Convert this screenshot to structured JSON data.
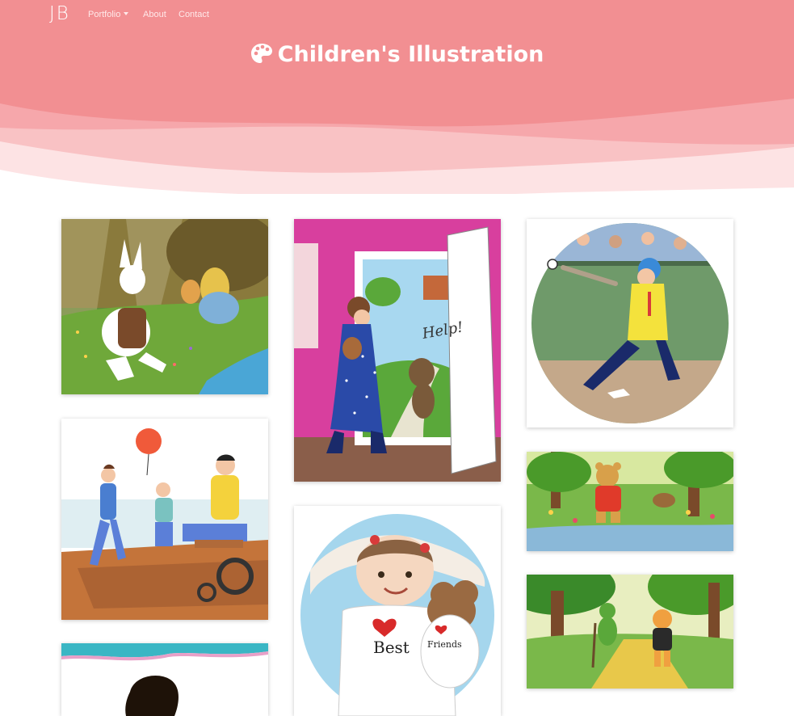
{
  "navbar": {
    "brand": "JB",
    "links": {
      "portfolio": "Portfolio",
      "about": "About",
      "contact": "Contact"
    }
  },
  "hero": {
    "title": "Children's Illustration",
    "icon": "palette-icon"
  },
  "colors": {
    "header_pink": "#f28f92",
    "wave_light": "#f8b3b6",
    "wave_pale": "#fddadb",
    "wave_white": "#fdeeee"
  },
  "gallery": {
    "items": [
      {
        "subject": "white-rabbit-with-alice"
      },
      {
        "subject": "girl-at-door-with-bear",
        "sign_text": "Help!"
      },
      {
        "subject": "boy-batting-baseball"
      },
      {
        "subject": "family-playing-with-balloon"
      },
      {
        "subject": "girl-with-teddy-bear",
        "shirt_text": "Best",
        "bear_shirt_text": "Friends"
      },
      {
        "subject": "bear-in-red-overalls"
      },
      {
        "subject": "frog-and-cat-on-yellow-road"
      },
      {
        "subject": "girl-portrait"
      }
    ]
  }
}
